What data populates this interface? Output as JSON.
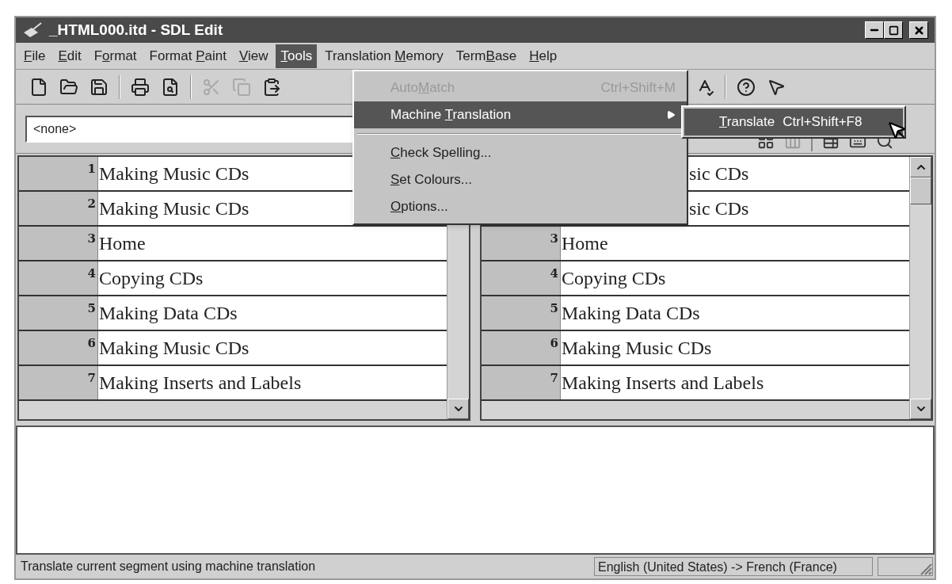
{
  "window": {
    "title": "_HTML000.itd - SDL Edit"
  },
  "menu_bar": [
    {
      "key": "F",
      "post": "ile",
      "selected": false
    },
    {
      "key": "E",
      "post": "dit",
      "selected": false
    },
    {
      "pre": "F",
      "key": "o",
      "post": "rmat",
      "selected": false
    },
    {
      "pre": "Format ",
      "key": "P",
      "post": "aint",
      "selected": false
    },
    {
      "key": "V",
      "post": "iew",
      "selected": false
    },
    {
      "key": "T",
      "post": "ools",
      "selected": true
    },
    {
      "pre": "Translation ",
      "key": "M",
      "post": "emory",
      "selected": false
    },
    {
      "pre": "Term",
      "key": "B",
      "post": "ase",
      "selected": false
    },
    {
      "key": "H",
      "post": "elp",
      "selected": false
    }
  ],
  "toolbar": [
    {
      "disabled": false
    },
    {
      "disabled": false
    },
    {
      "disabled": false
    },
    {
      "disabled": false
    },
    {
      "disabled": false
    },
    {
      "disabled": true
    },
    {
      "disabled": true
    },
    {
      "disabled": false
    },
    {
      "disabled": false
    },
    {
      "disabled": false
    },
    {
      "disabled": false
    }
  ],
  "style_box": {
    "value": "<none>"
  },
  "tools_menu": [
    {
      "kind": "item",
      "pre": "Auto",
      "key": "M",
      "post": "atch",
      "shortcut": "Ctrl+Shift+M",
      "disabled": true,
      "selected": false
    },
    {
      "kind": "submenu",
      "pre": "Machine ",
      "key": "T",
      "post": "ranslation",
      "disabled": false,
      "selected": true
    },
    {
      "kind": "separator"
    },
    {
      "kind": "item",
      "key": "C",
      "post": "heck Spelling...",
      "disabled": false,
      "selected": false
    },
    {
      "kind": "item",
      "key": "S",
      "post": "et Colours...",
      "disabled": false,
      "selected": false
    },
    {
      "kind": "item",
      "key": "O",
      "post": "ptions...",
      "disabled": false,
      "selected": false
    }
  ],
  "submenu": [
    {
      "key": "T",
      "post": "ranslate",
      "shortcut": "Ctrl+Shift+F8",
      "selected": true
    }
  ],
  "source_segments": [
    {
      "number": "1",
      "text": "Making Music CDs"
    },
    {
      "number": "2",
      "text": "Making Music CDs"
    },
    {
      "number": "3",
      "text": "Home"
    },
    {
      "number": "4",
      "text": "Copying CDs"
    },
    {
      "number": "5",
      "text": "Making Data CDs"
    },
    {
      "number": "6",
      "text": "Making Music CDs"
    },
    {
      "number": "7",
      "text": "Making Inserts and Labels"
    }
  ],
  "target_segments": [
    {
      "kind": "covered",
      "text": "sic CDs"
    },
    {
      "kind": "covered",
      "text": "sic CDs"
    },
    {
      "kind": "full",
      "number": "3",
      "text": "Home"
    },
    {
      "kind": "full",
      "number": "4",
      "text": "Copying CDs"
    },
    {
      "kind": "full",
      "number": "5",
      "text": "Making Data CDs"
    },
    {
      "kind": "full",
      "number": "6",
      "text": "Making Music CDs"
    },
    {
      "kind": "full",
      "number": "7",
      "text": "Making Inserts and Labels"
    }
  ],
  "status_bar": {
    "message": "Translate current segment using machine translation",
    "language_pair": "English (United States) -> French (France)"
  }
}
